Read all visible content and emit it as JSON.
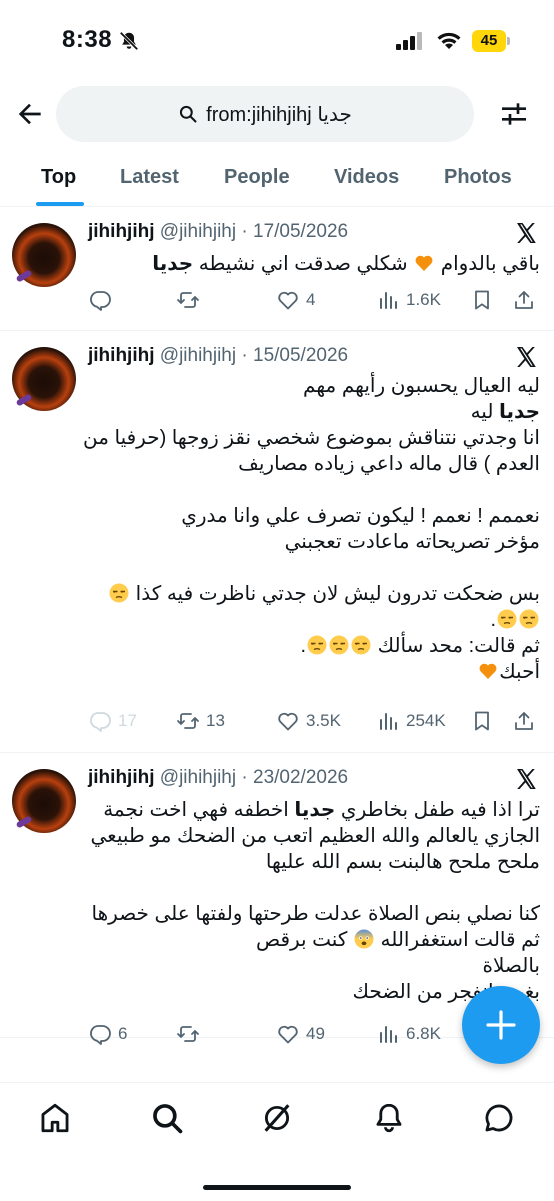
{
  "status_bar": {
    "time": "8:38",
    "battery": "45",
    "icons": [
      "bell-slash-icon",
      "cellular-signal-icon",
      "wifi-icon",
      "battery-icon"
    ]
  },
  "search": {
    "query_prefix": "from:jihihjihj",
    "query_term": "جديا",
    "icons": [
      "back-arrow-icon",
      "search-icon",
      "filter-sliders-icon"
    ]
  },
  "tabs": [
    {
      "label": "Top",
      "active": true
    },
    {
      "label": "Latest",
      "active": false
    },
    {
      "label": "People",
      "active": false
    },
    {
      "label": "Videos",
      "active": false
    },
    {
      "label": "Photos",
      "active": false
    }
  ],
  "tweets": [
    {
      "name": "jihihjihj",
      "handle": "@jihihjihj",
      "sep": " · ",
      "date": "17/05/2026",
      "lines": [
        {
          "parts": [
            {
              "t": "باقي بالدوام "
            },
            {
              "emoji": "orange-heart"
            },
            {
              "t": " شكلي صدقت اني نشيطه "
            },
            {
              "b": "جديا"
            }
          ]
        }
      ],
      "stats": {
        "replies": "",
        "reposts": "",
        "likes": "4",
        "views": "1.6K"
      },
      "replies_disabled": false
    },
    {
      "name": "jihihjihj",
      "handle": "@jihihjihj",
      "sep": " · ",
      "date": "15/05/2026",
      "lines": [
        {
          "parts": [
            {
              "t": "ليه العيال يحسبون رأيهم مهم"
            }
          ]
        },
        {
          "parts": [
            {
              "b": "جديا"
            },
            {
              "t": " ليه"
            }
          ]
        },
        {
          "parts": [
            {
              "t": "انا وجدتي نتناقش بموضوع شخصي نقز زوجها (حرفيا من"
            }
          ]
        },
        {
          "parts": [
            {
              "t": "العدم ) قال ماله داعي زياده مصاريف"
            }
          ]
        },
        {
          "blank": true
        },
        {
          "parts": [
            {
              "t": "نعممم ! نعمم ! ليكون تصرف علي وانا مدري"
            }
          ]
        },
        {
          "parts": [
            {
              "t": "مؤخر تصريحاته ماعادت تعجبني"
            }
          ]
        },
        {
          "blank": true
        },
        {
          "parts": [
            {
              "t": "بس ضحكت تدرون ليش لان جدتي ناظرت فيه كذا "
            },
            {
              "emoji": "unamused"
            }
          ]
        },
        {
          "parts": [
            {
              "emoji": "unamused"
            },
            {
              "emoji": "unamused"
            },
            {
              "t": "."
            }
          ]
        },
        {
          "parts": [
            {
              "t": "ثم قالت: محد سألك "
            },
            {
              "emoji": "unamused"
            },
            {
              "emoji": "unamused"
            },
            {
              "emoji": "unamused"
            },
            {
              "t": "."
            }
          ]
        },
        {
          "parts": [
            {
              "t": "أحبك"
            },
            {
              "emoji": "orange-heart"
            }
          ]
        }
      ],
      "stats": {
        "replies": "17",
        "reposts": "13",
        "likes": "3.5K",
        "views": "254K"
      },
      "replies_disabled": true
    },
    {
      "name": "jihihjihj",
      "handle": "@jihihjihj",
      "sep": " · ",
      "date": "23/02/2026",
      "lines": [
        {
          "parts": [
            {
              "t": "ترا اذا فيه طفل بخاطري "
            },
            {
              "b": "جديا"
            },
            {
              "t": " اخطفه فهي اخت نجمة"
            }
          ]
        },
        {
          "parts": [
            {
              "t": "الجازي يالعالم والله العظيم اتعب من الضحك مو طبيعي"
            }
          ]
        },
        {
          "parts": [
            {
              "t": "ملحح ملحح هالبنت بسم الله عليها"
            }
          ]
        },
        {
          "blank": true
        },
        {
          "parts": [
            {
              "t": "كنا نصلي بنص الصلاة عدلت طرحتها ولفتها على خصرها"
            }
          ]
        },
        {
          "parts": [
            {
              "t": "ثم قالت استغفرالله "
            },
            {
              "emoji": "fearful"
            },
            {
              "t": " كنت برقص"
            }
          ]
        },
        {
          "parts": [
            {
              "t": "بالصلاة"
            }
          ]
        },
        {
          "parts": [
            {
              "t": "بغيت انفجر من الضحك"
            }
          ]
        }
      ],
      "stats": {
        "replies": "6",
        "reposts": "",
        "likes": "49",
        "views": "6.8K"
      },
      "replies_disabled": false
    }
  ],
  "bottom_nav": [
    "home-icon",
    "search-icon",
    "grok-icon",
    "notifications-bell-icon",
    "messages-icon"
  ],
  "colors": {
    "accent": "#1d9bf0",
    "text": "#0f1419",
    "muted": "#536471",
    "divider": "#eff3f4"
  }
}
